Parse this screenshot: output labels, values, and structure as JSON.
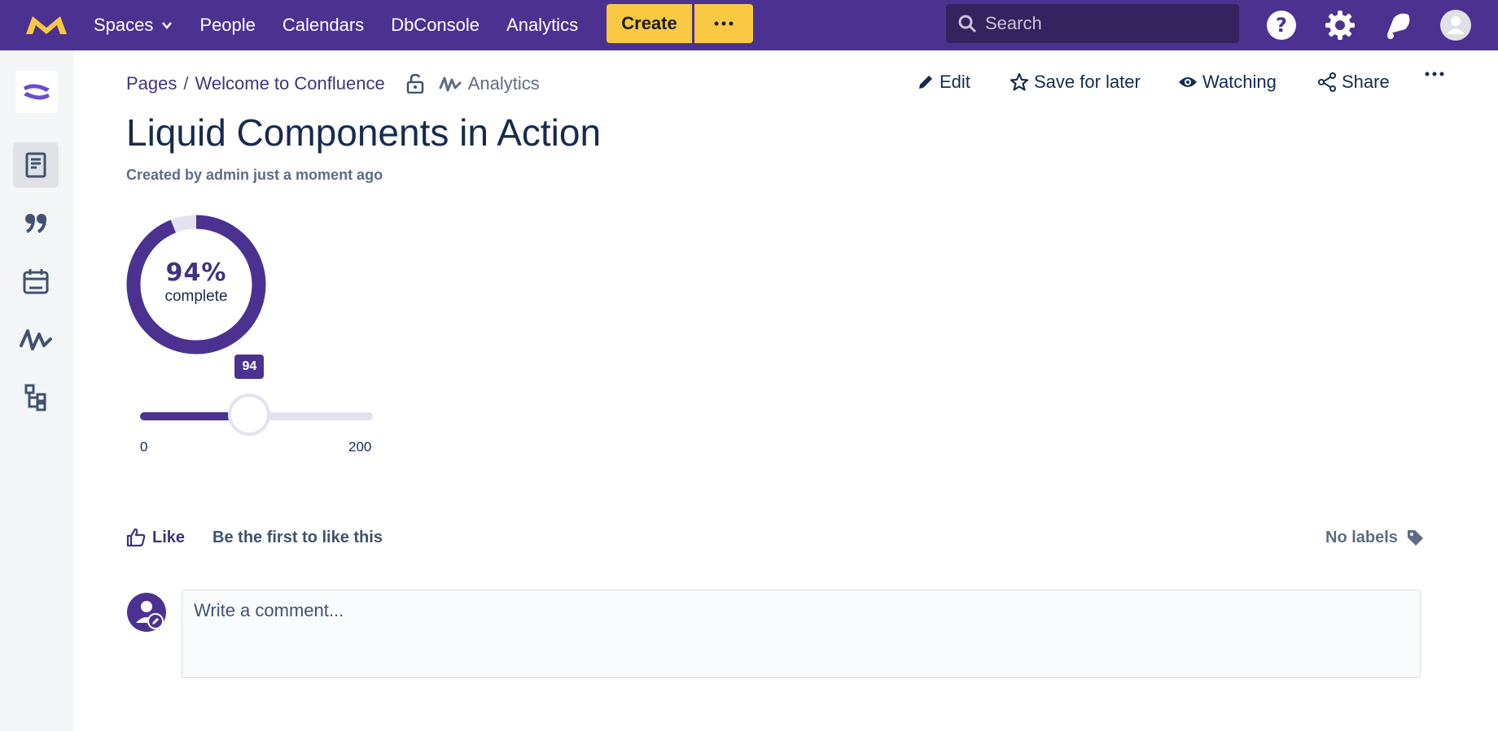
{
  "topnav": {
    "items": [
      {
        "label": "Spaces"
      },
      {
        "label": "People"
      },
      {
        "label": "Calendars"
      },
      {
        "label": "DbConsole"
      },
      {
        "label": "Analytics"
      }
    ],
    "create_label": "Create",
    "more_label": "···",
    "search_placeholder": "Search",
    "icons": [
      "help-icon",
      "settings-icon",
      "notifications-icon",
      "profile-avatar-icon"
    ]
  },
  "sidebar": {
    "items": [
      "pages-icon",
      "quote-icon",
      "calendar-icon",
      "analytics-icon",
      "tree-icon"
    ],
    "active": "pages-icon"
  },
  "breadcrumb": {
    "items": [
      "Pages",
      "Welcome to Confluence"
    ],
    "separator": "/",
    "analytics_label": "Analytics"
  },
  "actions": {
    "edit": "Edit",
    "save": "Save for later",
    "watching": "Watching",
    "share": "Share",
    "more": "···"
  },
  "page": {
    "title": "Liquid Components in Action",
    "byline": "Created by admin just a moment ago"
  },
  "progress": {
    "percent_text": "94%",
    "label": "complete",
    "value": 0.94
  },
  "slider": {
    "value": 94,
    "value_label": "94",
    "min": 0,
    "max": 200,
    "min_label": "0",
    "max_label": "200"
  },
  "likes": {
    "like_label": "Like",
    "info": "Be the first to like this"
  },
  "labels": {
    "text": "No labels"
  },
  "comment": {
    "placeholder": "Write a comment..."
  },
  "colors": {
    "brand": "#4b3291",
    "accent_yellow": "#f9c943",
    "link": "#42327f"
  }
}
